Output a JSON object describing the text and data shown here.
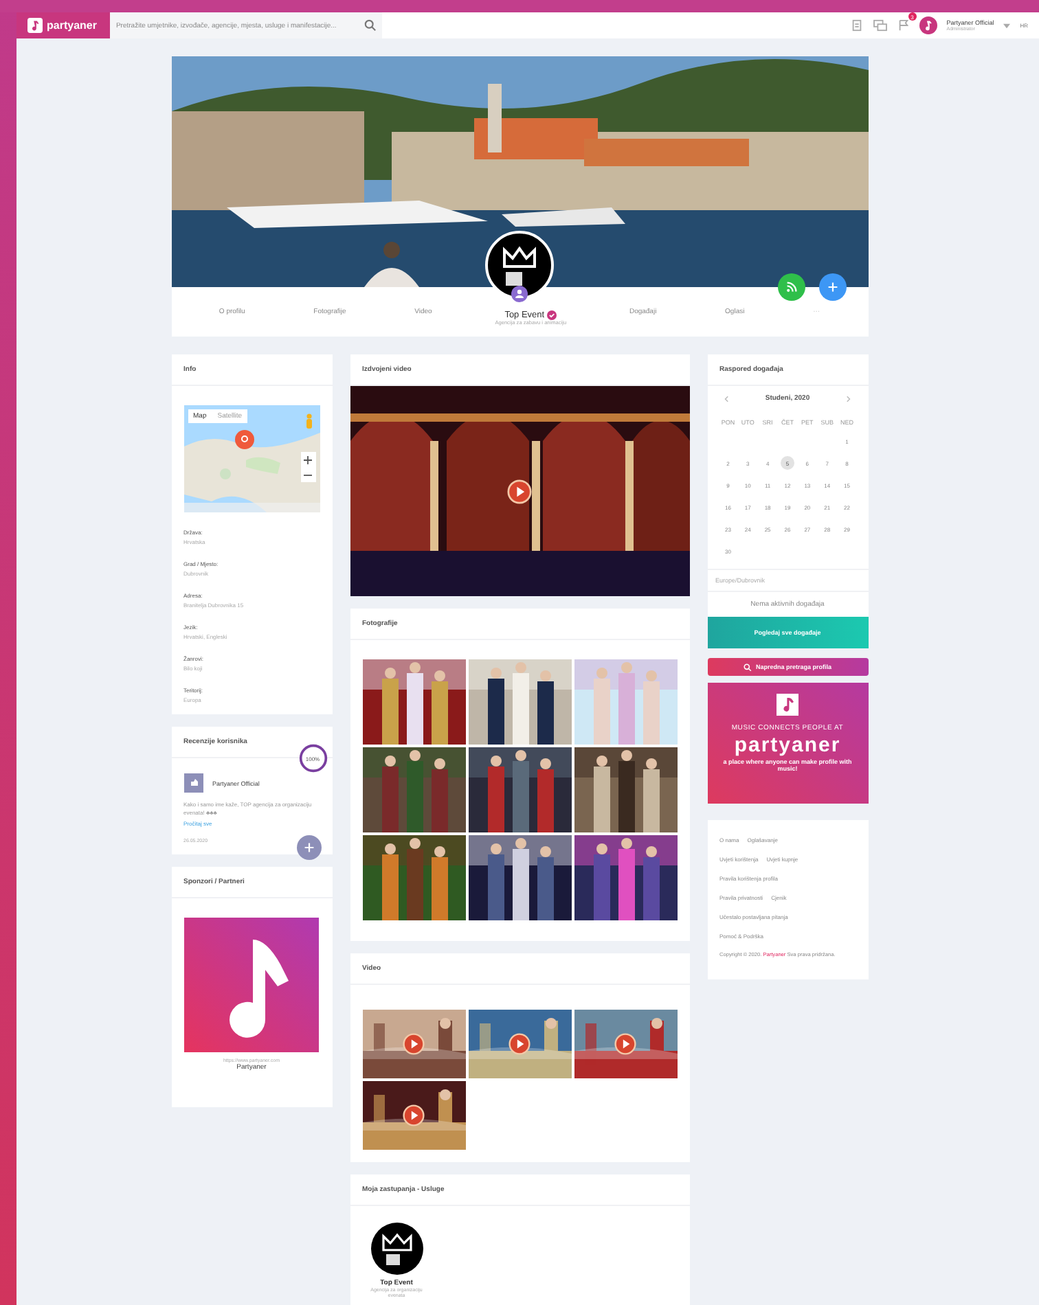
{
  "topbar": {
    "logo": "partyaner",
    "search": {
      "placeholder": "Pretražite umjetnike, izvođače, agencije, mjesta, usluge i manifestacije..."
    },
    "notification_count": "3",
    "user": {
      "name": "Partyaner Official",
      "role": "Administrator"
    },
    "language": "HR"
  },
  "profile": {
    "name": "Top Event",
    "verified": true,
    "subtitle": "Agencija za zabavu i animaciju",
    "tabs": [
      {
        "label": "O profilu",
        "selected": false
      },
      {
        "label": "Fotografije",
        "selected": false
      },
      {
        "label": "Video",
        "selected": false
      },
      {
        "label": "Događaji",
        "selected": false
      },
      {
        "label": "Oglasi",
        "selected": false
      }
    ],
    "more": "···"
  },
  "info": {
    "title": "Info",
    "map_controls": [
      "Map",
      "Satellite"
    ],
    "fields": [
      {
        "label": "Država:",
        "value": "Hrvatska"
      },
      {
        "label": "Grad / Mjesto:",
        "value": "Dubrovnik"
      },
      {
        "label": "Adresa:",
        "value": "Branitelja Dubrovnika 15"
      },
      {
        "label": "Jezik:",
        "value": "Hrvatski, Engleski"
      },
      {
        "label": "Žanrovi:",
        "value": "Bilo koji"
      },
      {
        "label": "Teritorij:",
        "value": "Europa"
      }
    ]
  },
  "reviews": {
    "title": "Recenzije korisnika",
    "score": "100%",
    "level": 1,
    "items": [
      {
        "author": "Partyaner Official",
        "text": "Kako i samo ime kaže, TOP agencija za organizaciju evenata! ♣♣♣",
        "read_more": "Pročitaj sve",
        "date": "26.05.2020"
      }
    ]
  },
  "sponsors": {
    "title": "Sponzori / Partneri",
    "items": [
      {
        "url": "https://www.partyaner.com",
        "name": "Partyaner"
      }
    ]
  },
  "featured_video": {
    "title": "Izdvojeni video"
  },
  "photos": {
    "title": "Fotografije"
  },
  "videos": {
    "title": "Video"
  },
  "services": {
    "title": "Moja zastupanja - Usluge",
    "items": [
      {
        "name": "Top Event",
        "desc": "Agencija za organizaciju evenata"
      }
    ]
  },
  "calendar": {
    "title": "Raspored događaja",
    "month": "Studeni, 2020",
    "weekdays": [
      "PON",
      "UTO",
      "SRI",
      "ČET",
      "PET",
      "SUB",
      "NED"
    ],
    "weeks": [
      [
        {
          "label": "1",
          "selected": false
        }
      ],
      [
        {
          "label": "2",
          "selected": false
        },
        {
          "label": "3",
          "selected": false
        },
        {
          "label": "4",
          "selected": false
        },
        {
          "label": "5",
          "selected": true
        },
        {
          "label": "6",
          "selected": false
        },
        {
          "label": "7",
          "selected": false
        },
        {
          "label": "8",
          "selected": false
        }
      ],
      [
        {
          "label": "9",
          "selected": false
        },
        {
          "label": "10",
          "selected": false
        },
        {
          "label": "11",
          "selected": false
        },
        {
          "label": "12",
          "selected": false
        },
        {
          "label": "13",
          "selected": false
        },
        {
          "label": "14",
          "selected": false
        },
        {
          "label": "15",
          "selected": false
        }
      ],
      [
        {
          "label": "16",
          "selected": false
        },
        {
          "label": "17",
          "selected": false
        },
        {
          "label": "18",
          "selected": false
        },
        {
          "label": "19",
          "selected": false
        },
        {
          "label": "20",
          "selected": false
        },
        {
          "label": "21",
          "selected": false
        },
        {
          "label": "22",
          "selected": false
        }
      ],
      [
        {
          "label": "23",
          "selected": false
        },
        {
          "label": "24",
          "selected": false
        },
        {
          "label": "25",
          "selected": false
        },
        {
          "label": "26",
          "selected": false
        },
        {
          "label": "27",
          "selected": false
        },
        {
          "label": "28",
          "selected": false
        },
        {
          "label": "29",
          "selected": false
        }
      ],
      [
        {
          "label": "30",
          "selected": false
        }
      ]
    ],
    "timezone": "Europe/Dubrovnik",
    "empty": "Nema aktivnih događaja",
    "button": "Pogledaj sve događaje"
  },
  "advanced_search": "Napredna pretraga profila",
  "ad": {
    "tagline": "MUSIC CONNECTS PEOPLE AT",
    "brand": "partyaner",
    "slogan": "a place where anyone can make profile with music!"
  },
  "footer": {
    "links": [
      [
        "O nama",
        "Oglašavanje"
      ],
      [
        "Uvjeti korištenja",
        "Uvjeti kupnje"
      ],
      [
        "Pravila korištenja profila"
      ],
      [
        "Pravila privatnosti",
        "Cjenik"
      ],
      [
        "Učestalo postavljana pitanja"
      ],
      [
        "Pomoć & Podrška"
      ]
    ],
    "copyright": {
      "before": "Copyright © 2020.",
      "brand": "Partyaner",
      "after": "Sva prava pridržana."
    }
  }
}
